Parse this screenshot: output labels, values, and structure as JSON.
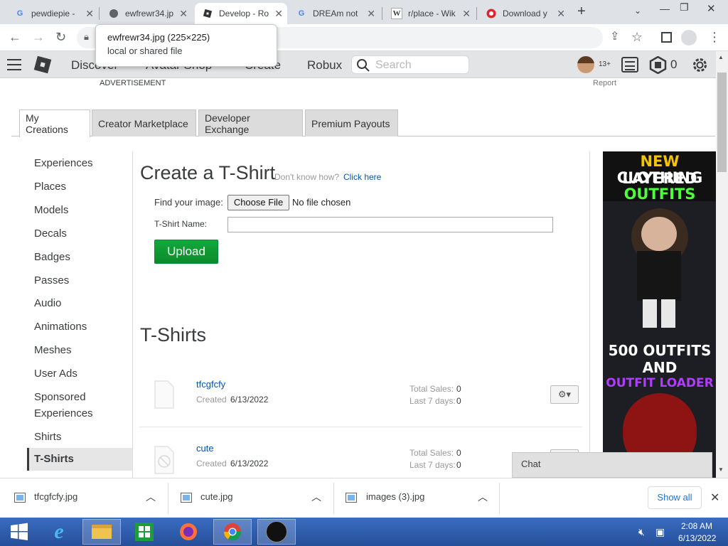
{
  "browser": {
    "tabs": [
      {
        "title": "pewdiepie -",
        "icon": "google-icon",
        "active": false
      },
      {
        "title": "ewfrewr34.jp",
        "icon": "globe-icon",
        "active": false
      },
      {
        "title": "Develop - Ro",
        "icon": "roblox-icon",
        "active": true
      },
      {
        "title": "DREAm not",
        "icon": "google-icon",
        "active": false
      },
      {
        "title": "r/place - Wik",
        "icon": "wikipedia-icon",
        "active": false
      },
      {
        "title": "Download y",
        "icon": "download-site-icon",
        "active": false
      }
    ],
    "tooltip": {
      "line1": "ewfrewr34.jpg (225×225)",
      "line2": "local or shared file"
    }
  },
  "roblox_nav": {
    "links": [
      "Discover",
      "Avatar Shop",
      "Create",
      "Robux"
    ],
    "search_placeholder": "Search",
    "age_badge": "13+",
    "robux_count": "0"
  },
  "ad": {
    "label": "ADVERTISEMENT",
    "report": "Report"
  },
  "page_tabs": [
    "My Creations",
    "Creator Marketplace",
    "Developer Exchange",
    "Premium Payouts"
  ],
  "sidebar": {
    "items": [
      "Experiences",
      "Places",
      "Models",
      "Decals",
      "Badges",
      "Passes",
      "Audio",
      "Animations",
      "Meshes",
      "User Ads",
      "Sponsored",
      "Experiences",
      "Shirts",
      "T-Shirts"
    ]
  },
  "create": {
    "title": "Create a T-Shirt",
    "help_text": "Don't know how?",
    "help_link": "Click here",
    "find_label": "Find your image:",
    "choose_button": "Choose File",
    "no_file": "No file chosen",
    "name_label": "T-Shirt Name:",
    "name_value": "",
    "upload_button": "Upload"
  },
  "list": {
    "title": "T-Shirts",
    "items": [
      {
        "name": "tfcgfcfy",
        "created_label": "Created",
        "created": "6/13/2022",
        "sales_label": "Total Sales:",
        "sales": "0",
        "last7_label": "Last 7 days:",
        "last7": "0"
      },
      {
        "name": "cute",
        "created_label": "Created",
        "created": "6/13/2022",
        "sales_label": "Total Sales:",
        "sales": "0",
        "last7_label": "Last 7 days:",
        "last7": "0"
      }
    ]
  },
  "ad_banner": {
    "line1a": "NEW",
    "line1b": "LAYERED",
    "line2": "CLOTHING",
    "line3": "OUTFITS",
    "line4": "500 OUTFITS",
    "line5": "AND",
    "line6": "OUTFIT LOADER"
  },
  "chat": {
    "label": "Chat"
  },
  "downloads": {
    "items": [
      "tfcgfcfy.jpg",
      "cute.jpg",
      "images (3).jpg"
    ],
    "show_all": "Show all"
  },
  "taskbar": {
    "time": "2:08 AM",
    "date": "6/13/2022"
  },
  "colors": {
    "upload_green": "#02b757",
    "link_blue": "#0055b3",
    "tab_bg": "#dee1e6"
  }
}
